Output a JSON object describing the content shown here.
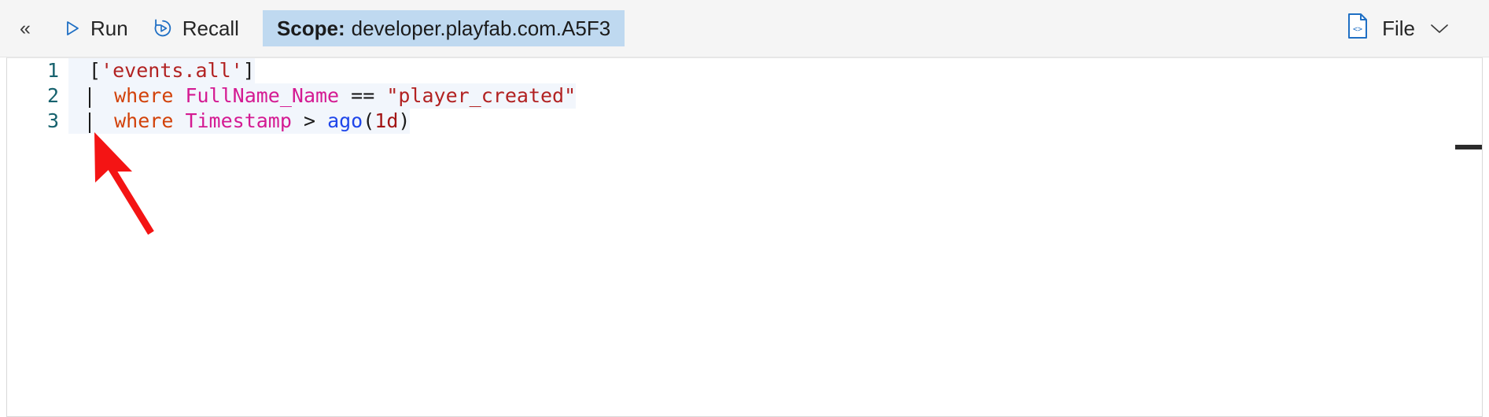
{
  "toolbar": {
    "collapse_label": "«",
    "collapse_icon": "double-chevron-left-icon",
    "run": {
      "label": "Run",
      "icon": "play-triangle-icon"
    },
    "recall": {
      "label": "Recall",
      "icon": "history-replay-icon"
    },
    "scope": {
      "key": "Scope:",
      "value": "developer.playfab.com.A5F3"
    },
    "file": {
      "label": "File",
      "icon": "code-file-icon",
      "caret_icon": "chevron-down-icon"
    }
  },
  "editor": {
    "line_numbers": [
      "1",
      "2",
      "3"
    ],
    "lines": [
      {
        "number": "1",
        "text": "['events.all']",
        "tokens": [
          {
            "t": "[",
            "c": "tok-bracket"
          },
          {
            "t": "'events.all'",
            "c": "tok-str"
          },
          {
            "t": "]",
            "c": "tok-bracket"
          }
        ]
      },
      {
        "number": "2",
        "text": "| where FullName_Name == \"player_created\"",
        "tokens": [
          {
            "t": "| ",
            "c": "tok-pipe"
          },
          {
            "t": "where",
            "c": "tok-kw"
          },
          {
            "t": " ",
            "c": "tok-op"
          },
          {
            "t": "FullName_Name",
            "c": "tok-col"
          },
          {
            "t": " == ",
            "c": "tok-op"
          },
          {
            "t": "\"player_created\"",
            "c": "tok-str"
          }
        ]
      },
      {
        "number": "3",
        "text": "| where Timestamp > ago(1d)",
        "tokens": [
          {
            "t": "| ",
            "c": "tok-pipe"
          },
          {
            "t": "where",
            "c": "tok-kw"
          },
          {
            "t": " ",
            "c": "tok-op"
          },
          {
            "t": "Timestamp",
            "c": "tok-col"
          },
          {
            "t": " > ",
            "c": "tok-op"
          },
          {
            "t": "ago",
            "c": "tok-fn"
          },
          {
            "t": "(",
            "c": "tok-punct"
          },
          {
            "t": "1d",
            "c": "tok-num"
          },
          {
            "t": ")",
            "c": "tok-punct"
          }
        ]
      }
    ]
  },
  "annotation": {
    "arrow_color": "#f41414",
    "arrow_name": "red-pointer-arrow"
  },
  "colors": {
    "toolbar_bg": "#f5f5f5",
    "scope_chip_bg": "#bfd9f0",
    "accent_blue": "#1f6fc4",
    "line_number": "#17626e",
    "line_highlight": "#f2f6fc",
    "string": "#b22222",
    "keyword": "#d2420a",
    "column": "#d41a92",
    "function": "#1f46ea",
    "number": "#a31515"
  }
}
